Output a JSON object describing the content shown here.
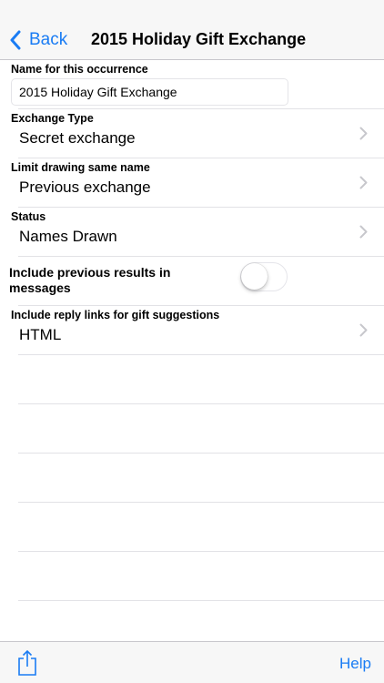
{
  "navbar": {
    "back_label": "Back",
    "title": "2015 Holiday Gift Exchange"
  },
  "form": {
    "name": {
      "label": "Name for this occurrence",
      "value": "2015 Holiday Gift Exchange"
    },
    "exchange_type": {
      "label": "Exchange Type",
      "value": "Secret exchange"
    },
    "limit_drawing": {
      "label": "Limit drawing same name",
      "value": "Previous exchange"
    },
    "status": {
      "label": "Status",
      "value": "Names Drawn"
    },
    "include_previous": {
      "label": "Include previous results in messages",
      "enabled": false
    },
    "reply_links": {
      "label": "Include reply links for gift suggestions",
      "value": "HTML"
    }
  },
  "toolbar": {
    "share_icon": "share-icon",
    "help_label": "Help"
  },
  "colors": {
    "accent": "#1a7cf4",
    "bar_background": "#f7f7f7",
    "separator": "#e2e2e6"
  }
}
